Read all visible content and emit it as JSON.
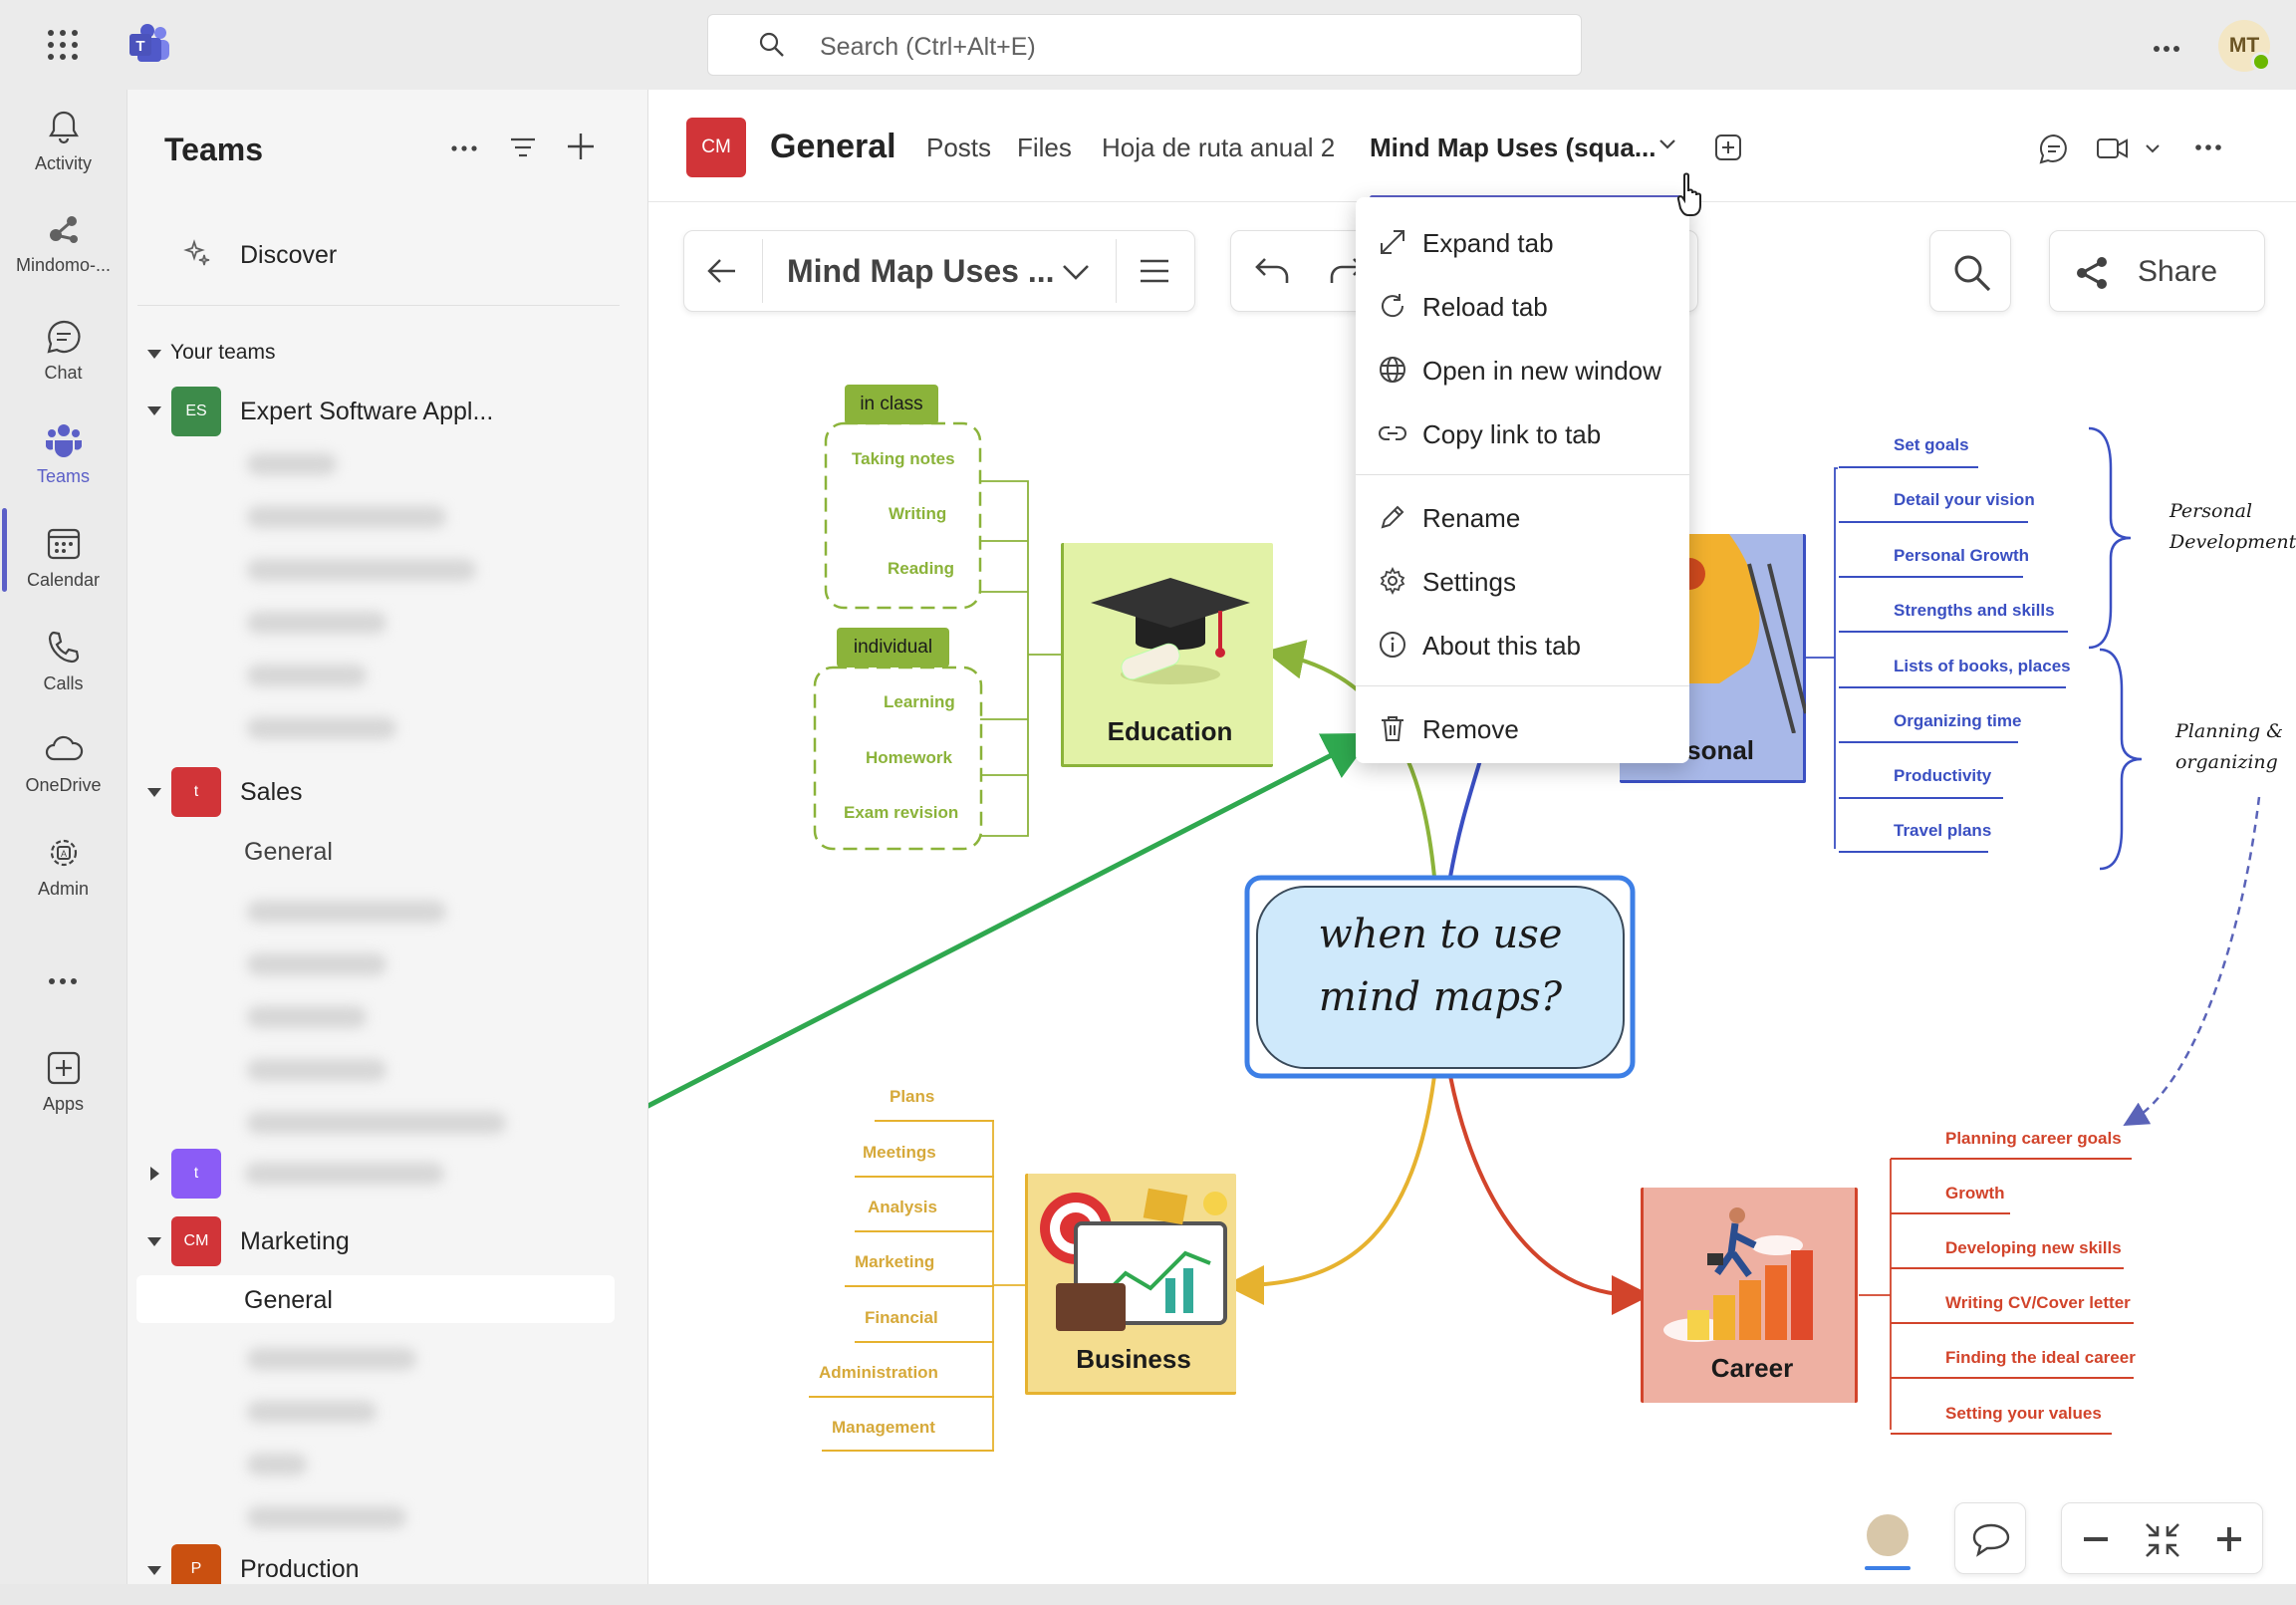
{
  "app": {
    "search_placeholder": "Search (Ctrl+Alt+E)",
    "user_initials": "MT"
  },
  "rail": [
    {
      "label": "Activity",
      "icon": "bell-icon"
    },
    {
      "label": "Mindomo-...",
      "icon": "mindomo-icon"
    },
    {
      "label": "Chat",
      "icon": "chat-icon"
    },
    {
      "label": "Teams",
      "icon": "teams-icon"
    },
    {
      "label": "Calendar",
      "icon": "calendar-icon"
    },
    {
      "label": "Calls",
      "icon": "phone-icon"
    },
    {
      "label": "OneDrive",
      "icon": "cloud-icon"
    },
    {
      "label": "Admin",
      "icon": "admin-icon"
    },
    {
      "label": "Apps",
      "icon": "add-app-icon"
    }
  ],
  "left_panel": {
    "title": "Teams",
    "discover": "Discover",
    "your_teams": "Your teams",
    "teams": [
      {
        "badge": "ES",
        "name": "Expert Software Appl...",
        "color": "#3d8b4a"
      },
      {
        "badge": "t",
        "name": "Sales",
        "color": "#d13438",
        "channel": "General"
      },
      {
        "badge": "t",
        "name": "",
        "color": "#8b5cf6"
      },
      {
        "badge": "CM",
        "name": "Marketing",
        "color": "#d13438",
        "channel": "General"
      },
      {
        "badge": "P",
        "name": "Production",
        "color": "#ca5010"
      }
    ]
  },
  "channel": {
    "badge": "CM",
    "name": "General",
    "tabs": [
      "Posts",
      "Files",
      "Hoja de ruta anual 2",
      "Mind Map Uses (squa..."
    ]
  },
  "context_menu": [
    {
      "label": "Expand tab",
      "icon": "expand-icon"
    },
    {
      "label": "Reload tab",
      "icon": "reload-icon"
    },
    {
      "label": "Open in new window",
      "icon": "globe-icon"
    },
    {
      "label": "Copy link to tab",
      "icon": "link-icon"
    },
    {
      "label": "Rename",
      "icon": "pencil-icon"
    },
    {
      "label": "Settings",
      "icon": "gear-icon"
    },
    {
      "label": "About this tab",
      "icon": "info-icon"
    },
    {
      "label": "Remove",
      "icon": "trash-icon"
    }
  ],
  "mindmap": {
    "toolbar_title": "Mind Map Uses ...",
    "share": "Share",
    "center": [
      "when to use",
      "mind maps?"
    ],
    "education": {
      "title": "Education",
      "in_class_tag": "in class",
      "in_class": [
        "Taking notes",
        "Writing",
        "Reading"
      ],
      "individual_tag": "individual",
      "individual": [
        "Learning",
        "Homework",
        "Exam revision"
      ]
    },
    "personal": {
      "title": "rsonal",
      "items": [
        "Set goals",
        "Detail your vision",
        "Personal Growth",
        "Strengths and skills",
        "Lists of books, places",
        "Organizing time",
        "Productivity",
        "Travel plans"
      ],
      "group1": [
        "Personal",
        "Development"
      ],
      "group2": [
        "Planning &",
        "organizing"
      ]
    },
    "business": {
      "title": "Business",
      "items": [
        "Plans",
        "Meetings",
        "Analysis",
        "Marketing",
        "Financial",
        "Administration",
        "Management"
      ]
    },
    "career": {
      "title": "Career",
      "items": [
        "Planning career goals",
        "Growth",
        "Developing new skills",
        "Writing CV/Cover letter",
        "Finding the ideal career",
        "Setting  your values"
      ]
    }
  },
  "colors": {
    "accent": "#5b5fc7",
    "education": "#8bb33a",
    "personal": "#3a4fc2",
    "business": "#d6a93a",
    "career": "#d2442b",
    "arrow": "#2fa84f"
  }
}
